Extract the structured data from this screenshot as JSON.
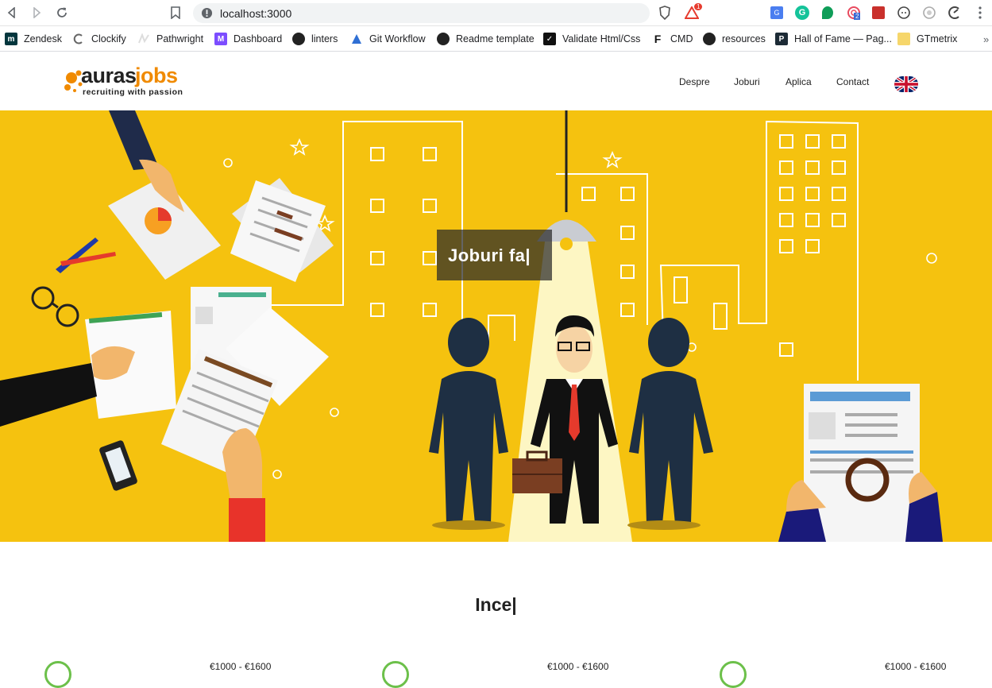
{
  "browser": {
    "url": "localhost:3000",
    "badge_count": "1",
    "ext_badge": "2",
    "bookmarks": [
      {
        "label": "Zendesk",
        "icon": "zendesk-icon"
      },
      {
        "label": "Clockify",
        "icon": "clockify-icon"
      },
      {
        "label": "Pathwright",
        "icon": "pathwright-icon"
      },
      {
        "label": "Dashboard",
        "icon": "dashboard-icon"
      },
      {
        "label": "linters",
        "icon": "github-icon"
      },
      {
        "label": "Git Workflow",
        "icon": "git-workflow-icon"
      },
      {
        "label": "Readme template",
        "icon": "github-icon"
      },
      {
        "label": "Validate Html/Css",
        "icon": "validator-icon"
      },
      {
        "label": "CMD",
        "icon": "cmd-icon"
      },
      {
        "label": "resources",
        "icon": "github-icon"
      },
      {
        "label": "Hall of Fame — Pag...",
        "icon": "hall-of-fame-icon"
      },
      {
        "label": "GTmetrix",
        "icon": "folder-icon"
      }
    ]
  },
  "site": {
    "logo_word1": "auras",
    "logo_word2": "jobs",
    "logo_tagline": "recruiting with passion",
    "nav": [
      "Despre",
      "Joburi",
      "Aplica",
      "Contact"
    ],
    "language_flag": "uk-flag-icon",
    "brand_color": "#f08a00",
    "hero_color": "#f5c20f"
  },
  "hero": {
    "caption": "Joburi fa|"
  },
  "content": {
    "section_title": "Ince|",
    "jobs": [
      {
        "salary": "€1000 - €1600"
      },
      {
        "salary": "€1000 - €1600"
      },
      {
        "salary": "€1000 - €1600"
      }
    ]
  }
}
